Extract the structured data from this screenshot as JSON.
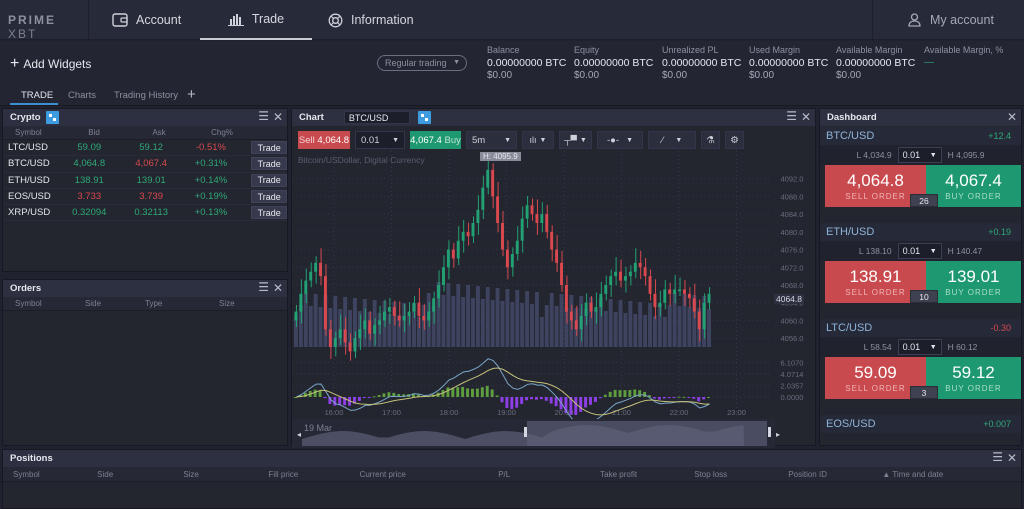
{
  "brand": {
    "logo": "PRIME",
    "logo_x": "XBT"
  },
  "nav": {
    "account": "Account",
    "trade": "Trade",
    "information": "Information",
    "my_account": "My account"
  },
  "subbar": {
    "add_widgets": "Add Widgets",
    "mode_select": "Regular trading",
    "metrics": [
      {
        "label": "Balance",
        "btc": "0.00000000 BTC",
        "usd": "$0.00"
      },
      {
        "label": "Equity",
        "btc": "0.00000000 BTC",
        "usd": "$0.00"
      },
      {
        "label": "Unrealized PL",
        "btc": "0.00000000 BTC",
        "usd": "$0.00"
      },
      {
        "label": "Used Margin",
        "btc": "0.00000000 BTC",
        "usd": "$0.00"
      },
      {
        "label": "Available Margin",
        "btc": "0.00000000 BTC",
        "usd": "$0.00"
      },
      {
        "label": "Available Margin, %",
        "value": "—"
      }
    ]
  },
  "tabs": [
    {
      "label": "TRADE",
      "active": true
    },
    {
      "label": "Charts"
    },
    {
      "label": "Trading History"
    },
    {
      "label": "+"
    }
  ],
  "crypto": {
    "title": "Crypto",
    "columns": [
      "Symbol",
      "Bid",
      "Ask",
      "Chg%"
    ],
    "trade_label": "Trade",
    "rows": [
      {
        "symbol": "LTC/USD",
        "bid": "59.09",
        "bid_dir": "up",
        "ask": "59.12",
        "ask_dir": "up",
        "chg": "-0.51%",
        "chg_dir": "down"
      },
      {
        "symbol": "BTC/USD",
        "bid": "4,064.8",
        "bid_dir": "up",
        "ask": "4,067.4",
        "ask_dir": "down",
        "chg": "+0.31%",
        "chg_dir": "up"
      },
      {
        "symbol": "ETH/USD",
        "bid": "138.91",
        "bid_dir": "up",
        "ask": "139.01",
        "ask_dir": "up",
        "chg": "+0.14%",
        "chg_dir": "up"
      },
      {
        "symbol": "EOS/USD",
        "bid": "3.733",
        "bid_dir": "down",
        "ask": "3.739",
        "ask_dir": "down",
        "chg": "+0.19%",
        "chg_dir": "up"
      },
      {
        "symbol": "XRP/USD",
        "bid": "0.32094",
        "bid_dir": "up",
        "ask": "0.32113",
        "ask_dir": "up",
        "chg": "+0.13%",
        "chg_dir": "up"
      }
    ]
  },
  "orders": {
    "title": "Orders",
    "columns": [
      "Symbol",
      "Side",
      "Type",
      "Size"
    ]
  },
  "chart": {
    "title": "Chart",
    "symbol": "BTC/USD",
    "sell_label": "Sell",
    "sell_price": "4,064.8",
    "quantity": "0.01",
    "buy_price": "4,067.4",
    "buy_label": "Buy",
    "interval": "5m",
    "instrument_desc": "Bitcoin/USDollar, Digital Currency",
    "high_tag": "H: 4095.9",
    "last_price": "4064.8",
    "range_date": "19 Mar"
  },
  "chart_data": {
    "type": "candlestick",
    "title": "Bitcoin/USDollar, Digital Currency",
    "price_ticks": [
      "4092.0",
      "4088.0",
      "4084.0",
      "4080.0",
      "4076.0",
      "4072.0",
      "4068.0",
      "4064.0",
      "4060.0",
      "4056.0"
    ],
    "price_range": [
      4054,
      4096
    ],
    "macd_ticks": [
      "6.1070",
      "4.0714",
      "2.0357",
      "0.0000"
    ],
    "time_ticks": [
      "16:00",
      "17:00",
      "18:00",
      "19:00",
      "20:00",
      "21:00",
      "22:00",
      "23:00"
    ],
    "close_series": [
      4062,
      4066,
      4069,
      4071,
      4073,
      4070,
      4058,
      4054,
      4056,
      4058,
      4055,
      4053,
      4056,
      4058,
      4060,
      4057,
      4059,
      4060,
      4062,
      4063,
      4061,
      4060,
      4061,
      4062,
      4064,
      4061,
      4060,
      4062,
      4065,
      4068,
      4072,
      4076,
      4074,
      4078,
      4080,
      4079,
      4082,
      4085,
      4090,
      4094,
      4088,
      4082,
      4076,
      4072,
      4075,
      4078,
      4083,
      4086,
      4084,
      4082,
      4084,
      4080,
      4076,
      4073,
      4068,
      4062,
      4060,
      4058,
      4061,
      4064,
      4062,
      4063,
      4066,
      4068,
      4070,
      4071,
      4069,
      4070,
      4071,
      4073,
      4072,
      4070,
      4066,
      4063,
      4064,
      4067,
      4066,
      4067,
      4067,
      4066,
      4065,
      4062,
      4058,
      4064,
      4066
    ]
  },
  "dashboard": {
    "title": "Dashboard",
    "sell_order": "SELL ORDER",
    "buy_order": "BUY ORDER",
    "items": [
      {
        "symbol": "BTC/USD",
        "change": "+12.4",
        "change_dir": "up",
        "low": "L 4,034.9",
        "qty": "0.01",
        "high": "H 4,095.9",
        "sell": "4,064.8",
        "buy": "4,067.4",
        "spread": "26"
      },
      {
        "symbol": "ETH/USD",
        "change": "+0.19",
        "change_dir": "up",
        "low": "L 138.10",
        "qty": "0.01",
        "high": "H 140.47",
        "sell": "138.91",
        "buy": "139.01",
        "spread": "10"
      },
      {
        "symbol": "LTC/USD",
        "change": "-0.30",
        "change_dir": "down",
        "low": "L 58.54",
        "qty": "0.01",
        "high": "H 60.12",
        "sell": "59.09",
        "buy": "59.12",
        "spread": "3"
      },
      {
        "symbol": "EOS/USD",
        "change": "+0.007",
        "change_dir": "up"
      }
    ]
  },
  "positions": {
    "title": "Positions",
    "columns": [
      "Symbol",
      "Side",
      "Size",
      "Fill price",
      "Current price",
      "P/L",
      "Take profit",
      "Stop loss",
      "Position ID",
      "▲ Time and date"
    ]
  },
  "colors": {
    "up": "#2fa978",
    "down": "#d9494f",
    "accent": "#3d9be0",
    "sell_bg": "#c84a4f",
    "buy_bg": "#1e9870",
    "macd_pos": "#5f9e3e",
    "macd_neg": "#8f3fe8"
  }
}
